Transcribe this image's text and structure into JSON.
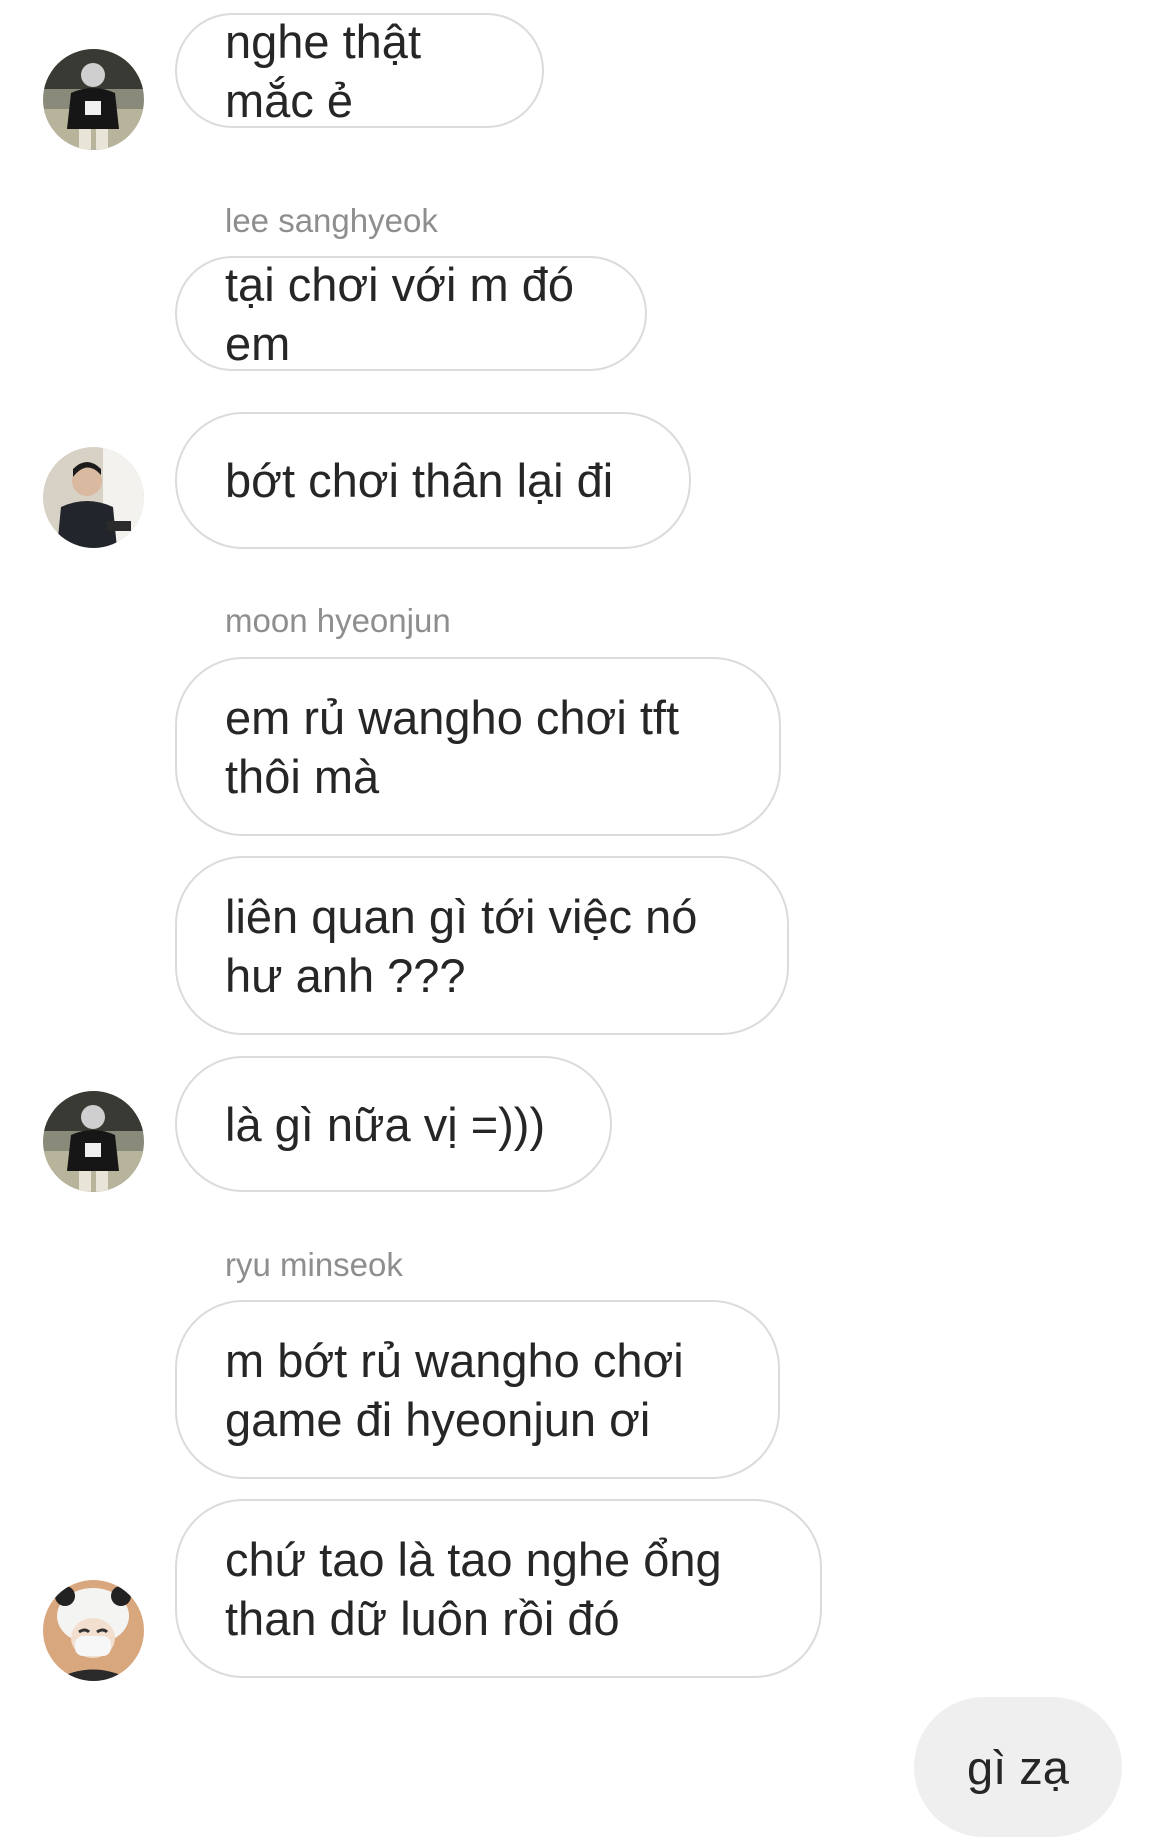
{
  "messages": [
    {
      "sender": "",
      "text": "nghe thật mắc ẻ",
      "direction": "in",
      "avatar": "avatar-1"
    },
    {
      "sender": "lee sanghyeok",
      "text": "tại chơi với m đó em",
      "direction": "in"
    },
    {
      "sender": "",
      "text": "bớt chơi thân lại đi",
      "direction": "in",
      "avatar": "avatar-2"
    },
    {
      "sender": "moon hyeonjun",
      "text": "em rủ wangho chơi tft thôi mà",
      "direction": "in"
    },
    {
      "sender": "",
      "text": "liên quan gì tới việc nó hư anh ???",
      "direction": "in"
    },
    {
      "sender": "",
      "text": "là gì nữa vị =)))",
      "direction": "in",
      "avatar": "avatar-1"
    },
    {
      "sender": "ryu minseok",
      "text": "m bớt rủ wangho chơi game đi hyeonjun ơi",
      "direction": "in"
    },
    {
      "sender": "",
      "text": "chứ tao là tao nghe ổng than dữ luôn rồi đó",
      "direction": "in",
      "avatar": "avatar-3"
    },
    {
      "sender": "",
      "text": "gì zạ",
      "direction": "out"
    }
  ],
  "colors": {
    "incoming_border": "#dbdbdb",
    "outgoing_bg": "#efefef",
    "sender_label": "#8e8e8e",
    "text": "#262626"
  }
}
